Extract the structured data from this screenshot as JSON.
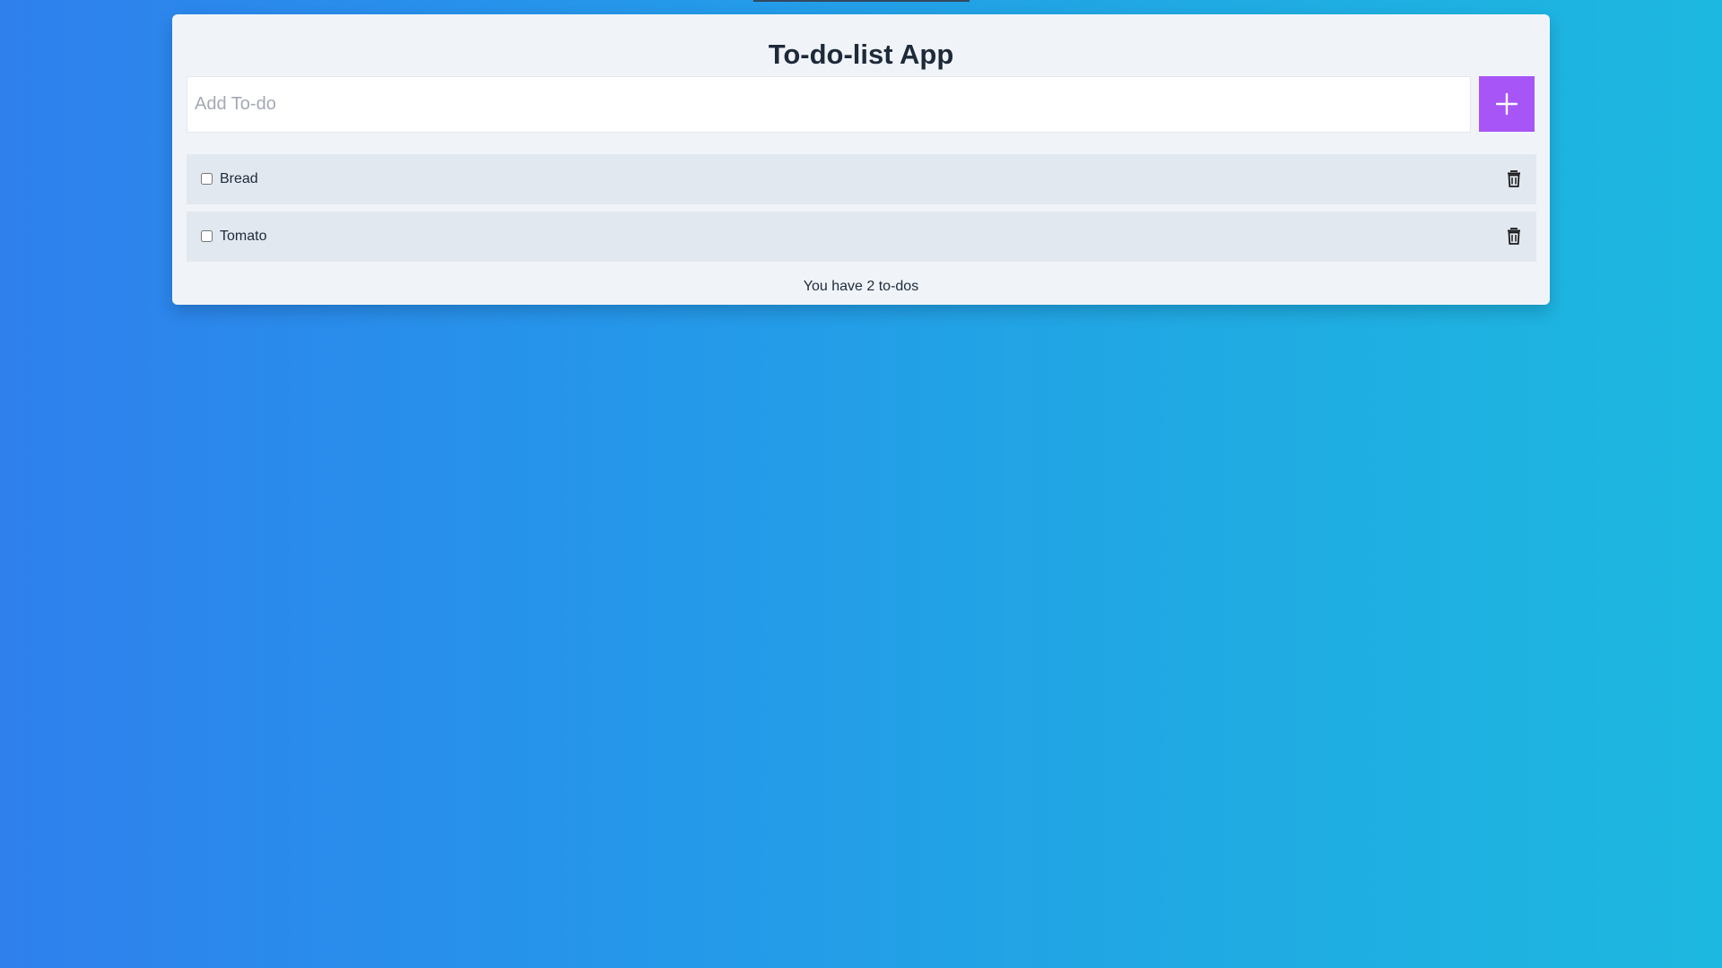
{
  "app": {
    "title": "To-do-list App"
  },
  "add_form": {
    "placeholder": "Add To-do",
    "value": "",
    "add_icon": "plus-icon",
    "button_color": "#a855f7"
  },
  "todos": [
    {
      "label": "Bread",
      "checked": false,
      "delete_icon": "trash-icon"
    },
    {
      "label": "Tomato",
      "checked": false,
      "delete_icon": "trash-icon"
    }
  ],
  "footer": {
    "count_text": "You have 2 to-dos"
  },
  "colors": {
    "background_start": "#2f80ed",
    "background_end": "#1db8e0",
    "card": "#f0f4f8",
    "item": "#e2e8f0",
    "accent": "#a855f7"
  }
}
